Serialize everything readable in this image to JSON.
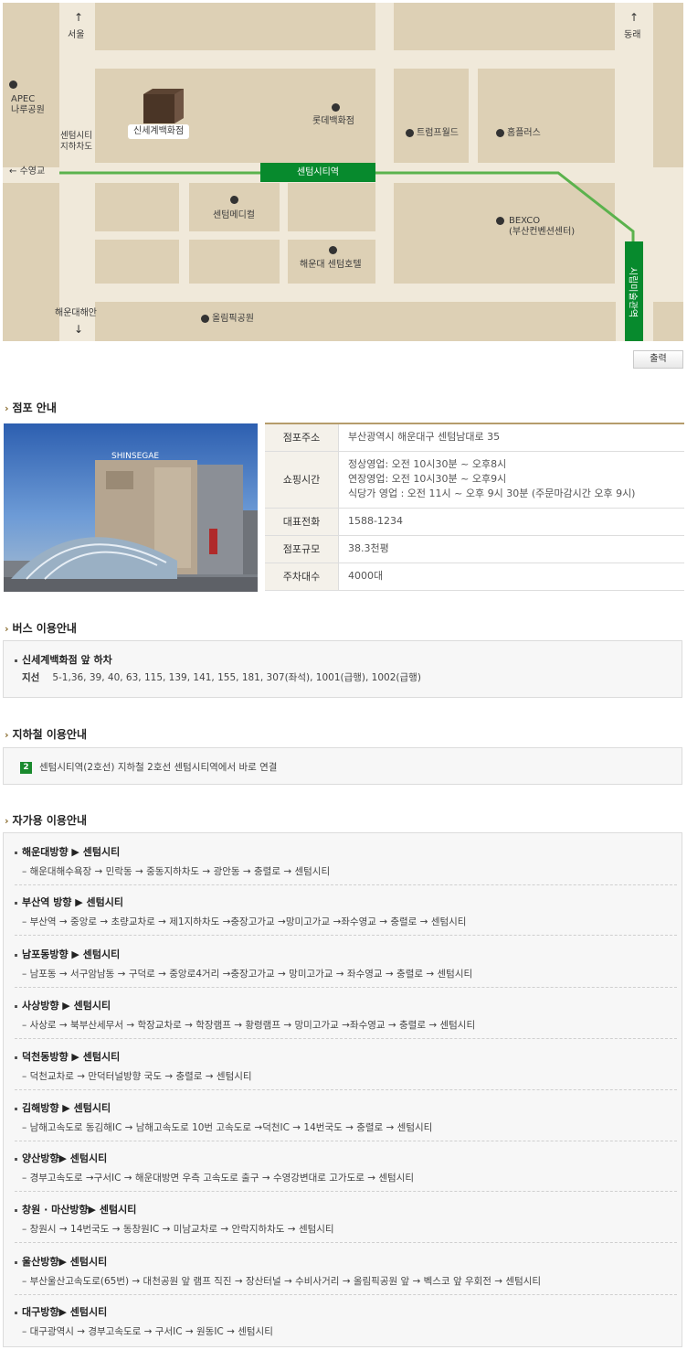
{
  "map": {
    "labels": {
      "seoul": "서울",
      "dongrae": "동래",
      "apec": "APEC\n나루공원",
      "shinsegae": "신세계백화점",
      "lotte": "롯데백화점",
      "underpass": "센텀시티\n지하차도",
      "trump": "트럼프월드",
      "homeplus": "홈플러스",
      "suyeonggyo": "수영교",
      "station": "센텀시티역",
      "medical": "센텀메디컬",
      "bexco": "BEXCO\n(부산컨벤션센터)",
      "hotel": "해운대 센텀호텔",
      "museum_station": "시립미술관역",
      "haeundae_coast": "해운대해안",
      "olympic_park": "올림픽공원"
    }
  },
  "print_label": "출력",
  "store": {
    "title": "점포 안내",
    "photo_sign": "SHINSEGAE",
    "rows": [
      {
        "label": "점포주소",
        "value": "부산광역시 해운대구 센텀남대로 35"
      },
      {
        "label": "쇼핑시간",
        "value": "정상영업: 오전 10시30분 ~ 오후8시\n연장영업: 오전 10시30분 ~ 오후9시\n식당가 영업 : 오전 11시 ~ 오후 9시 30분 (주문마감시간 오후 9시)"
      },
      {
        "label": "대표전화",
        "value": "1588-1234"
      },
      {
        "label": "점포규모",
        "value": "38.3천평"
      },
      {
        "label": "주차대수",
        "value": "4000대"
      }
    ]
  },
  "bus": {
    "title": "버스 이용안내",
    "stop": "신세계백화점 앞 하차",
    "route_type": "지선",
    "routes": "5-1,36, 39, 40, 63, 115, 139, 141, 155, 181, 307(좌석), 1001(급행), 1002(급행)"
  },
  "subway": {
    "title": "지하철 이용안내",
    "line_badge": "2",
    "text": "센텀시티역(2호선) 지하철 2호선 센텀시티역에서 바로 연결"
  },
  "car": {
    "title": "자가용 이용안내",
    "items": [
      {
        "title": "해운대방향 ▶ 센텀시티",
        "route": "– 해운대해수욕장 → 민락동 → 중동지하차도 → 광안동 → 충렬로 → 센텀시티"
      },
      {
        "title": "부산역 방향 ▶ 센텀시티",
        "route": "– 부산역 → 중앙로 → 초량교차로 → 제1지하차도 →충장고가교 →망미고가교 →좌수영교 → 충렬로 → 센텀시티"
      },
      {
        "title": "남포동방향 ▶ 센텀시티",
        "route": "– 남포동 → 서구암남동 → 구덕로 → 중앙로4거리 →충장고가교 → 망미고가교 → 좌수영교 → 충렬로 → 센텀시티"
      },
      {
        "title": "사상방향 ▶ 센텀시티",
        "route": "– 사상로 → 북부산세무서 → 학장교차로 → 학장램프 → 황령램프 → 망미고가교 →좌수영교 → 충렬로 → 센텀시티"
      },
      {
        "title": "덕천동방향 ▶ 센텀시티",
        "route": "– 덕천교차로 → 만덕터널방향 국도 → 충렬로 → 센텀시티"
      },
      {
        "title": "김해방향 ▶ 센텀시티",
        "route": "– 남해고속도로 동김해IC → 남해고속도로 10번 고속도로 →덕천IC → 14번국도 → 충렬로 → 센텀시티"
      },
      {
        "title": "양산방향▶ 센텀시티",
        "route": "– 경부고속도로 →구서IC → 해운대방면 우측 고속도로 출구 → 수영강변대로 고가도로 → 센텀시티"
      },
      {
        "title": "창원 · 마산방향▶ 센텀시티",
        "route": "– 창원시 → 14번국도 → 동창원IC → 미남교차로 → 안락지하차도 → 센텀시티"
      },
      {
        "title": "울산방향▶ 센텀시티",
        "route": "– 부산울산고속도로(65번) → 대천공원 앞 램프 직진 → 장산터널 → 수비사거리 → 올림픽공원 앞 → 벡스코 앞 우회전 → 센텀시티"
      },
      {
        "title": "대구방향▶ 센텀시티",
        "route": "– 대구광역시 → 경부고속도로 → 구서IC → 원동IC → 센텀시티"
      }
    ]
  }
}
